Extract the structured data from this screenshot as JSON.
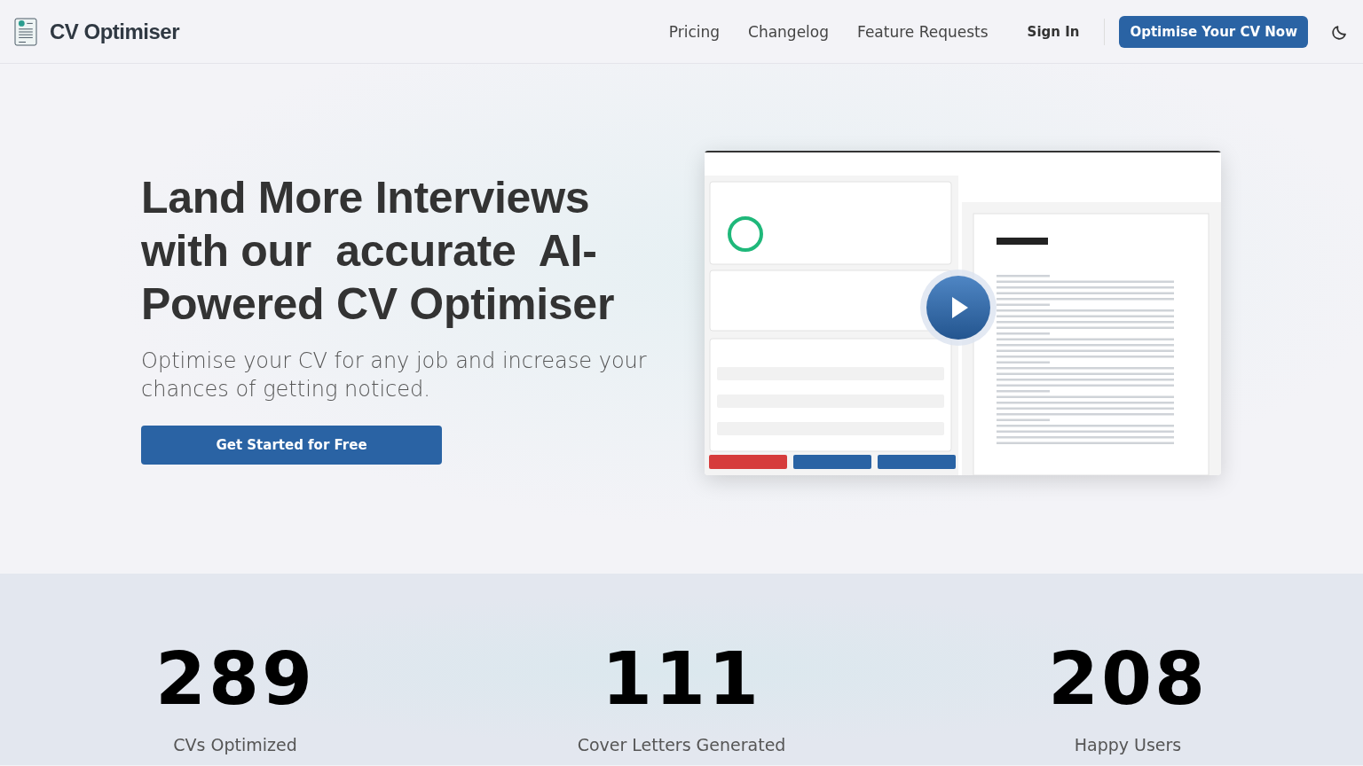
{
  "header": {
    "brand": "CV Optimiser",
    "nav": [
      {
        "label": "Pricing"
      },
      {
        "label": "Changelog"
      },
      {
        "label": "Feature Requests"
      }
    ],
    "sign_in": "Sign In",
    "cta": "Optimise Your CV Now"
  },
  "hero": {
    "title_lines": [
      "Land More Interviews",
      "with our  accurate  AI-",
      "Powered CV Optimiser"
    ],
    "subtitle": "Optimise your CV for any job and increase your chances of getting noticed.",
    "button": "Get Started for Free"
  },
  "stats": [
    {
      "value": "289",
      "label": "CVs Optimized"
    },
    {
      "value": "111",
      "label": "Cover Letters Generated"
    },
    {
      "value": "208",
      "label": "Happy Users"
    }
  ]
}
